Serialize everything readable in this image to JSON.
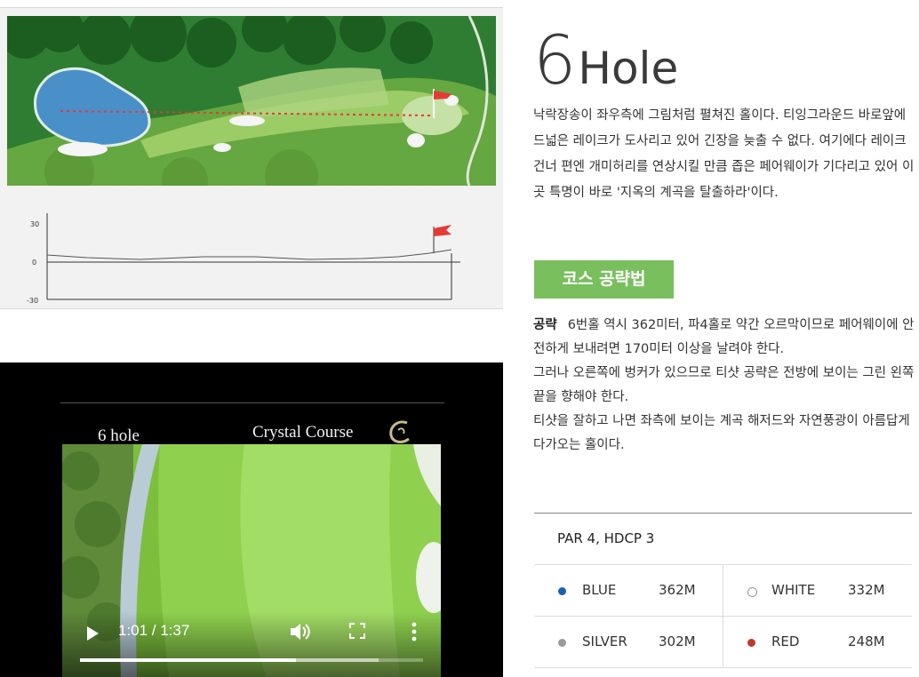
{
  "elevation_labels": {
    "top": "30",
    "mid": "0",
    "bottom": "-30"
  },
  "video": {
    "hole_label": "6 hole",
    "course_label": "Crystal Course",
    "time": "1:01 / 1:37",
    "progress": 0.63,
    "buffered": 0.87
  },
  "hole": {
    "number": "6",
    "word": "Hole",
    "description": "낙락장송이 좌우측에 그림처럼 펼쳐진 홀이다. 티잉그라운드 바로앞에 드넓은 레이크가 도사리고 있어 긴장을 늦출 수 없다. 여기에다 레이크 건너 편엔 개미허리를 연상시킬 만큼 좁은 페어웨이가 기다리고 있어 이곳 특명이 바로 '지옥의 계곡을 탈출하라'이다."
  },
  "strategy": {
    "badge": "코스 공략법",
    "label": "공략",
    "lines": [
      "6번홀 역시 362미터, 파4홀로 약간 오르막이므로 페어웨이에 안전하게 보내려면 170미터 이상을 날려야 한다.",
      "그러나 오른쪽에 벙커가 있으므로 티샷 공략은 전방에 보이는 그린 왼쪽 끝을 향해야 한다.",
      "티샷을 잘하고 나면 좌측에 보이는 계곡 해저드와 자연풍광이 아름답게 다가오는 홀이다."
    ]
  },
  "par_info": "PAR 4, HDCP 3",
  "tees": [
    {
      "name": "BLUE",
      "distance": "362M",
      "color": "#1a5fb4"
    },
    {
      "name": "WHITE",
      "distance": "332M",
      "color": "#ffffff"
    },
    {
      "name": "SILVER",
      "distance": "302M",
      "color": "#9a9a9a"
    },
    {
      "name": "RED",
      "distance": "248M",
      "color": "#c0392b"
    }
  ]
}
